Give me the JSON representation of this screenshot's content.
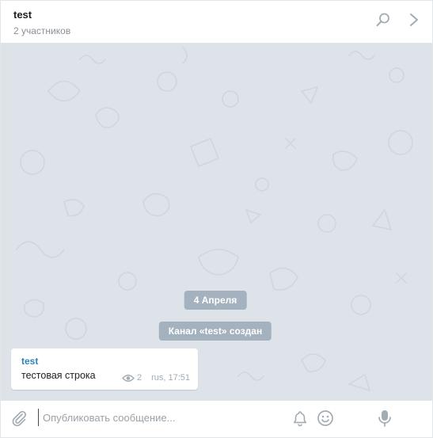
{
  "header": {
    "title": "test",
    "subtitle": "2 участников",
    "icons": {
      "search": "search-icon",
      "next": "chevron-right-icon"
    }
  },
  "conversation": {
    "background_color": "#dde3e8",
    "date_pill": "4 Апреля",
    "service_message": "Канал «test» создан",
    "messages": [
      {
        "author": "test",
        "text": "тестовая строка",
        "views": "2",
        "signature": "rus, 17:51"
      }
    ]
  },
  "composer": {
    "placeholder": "Опубликовать сообщение...",
    "value": "",
    "icons": {
      "attach": "paperclip-icon",
      "notifications": "bell-icon",
      "emoji": "smiley-icon",
      "voice": "microphone-icon"
    }
  },
  "colors": {
    "accent": "#2e83b3",
    "pill": "#97a6b4",
    "icon": "#a2acb3"
  }
}
